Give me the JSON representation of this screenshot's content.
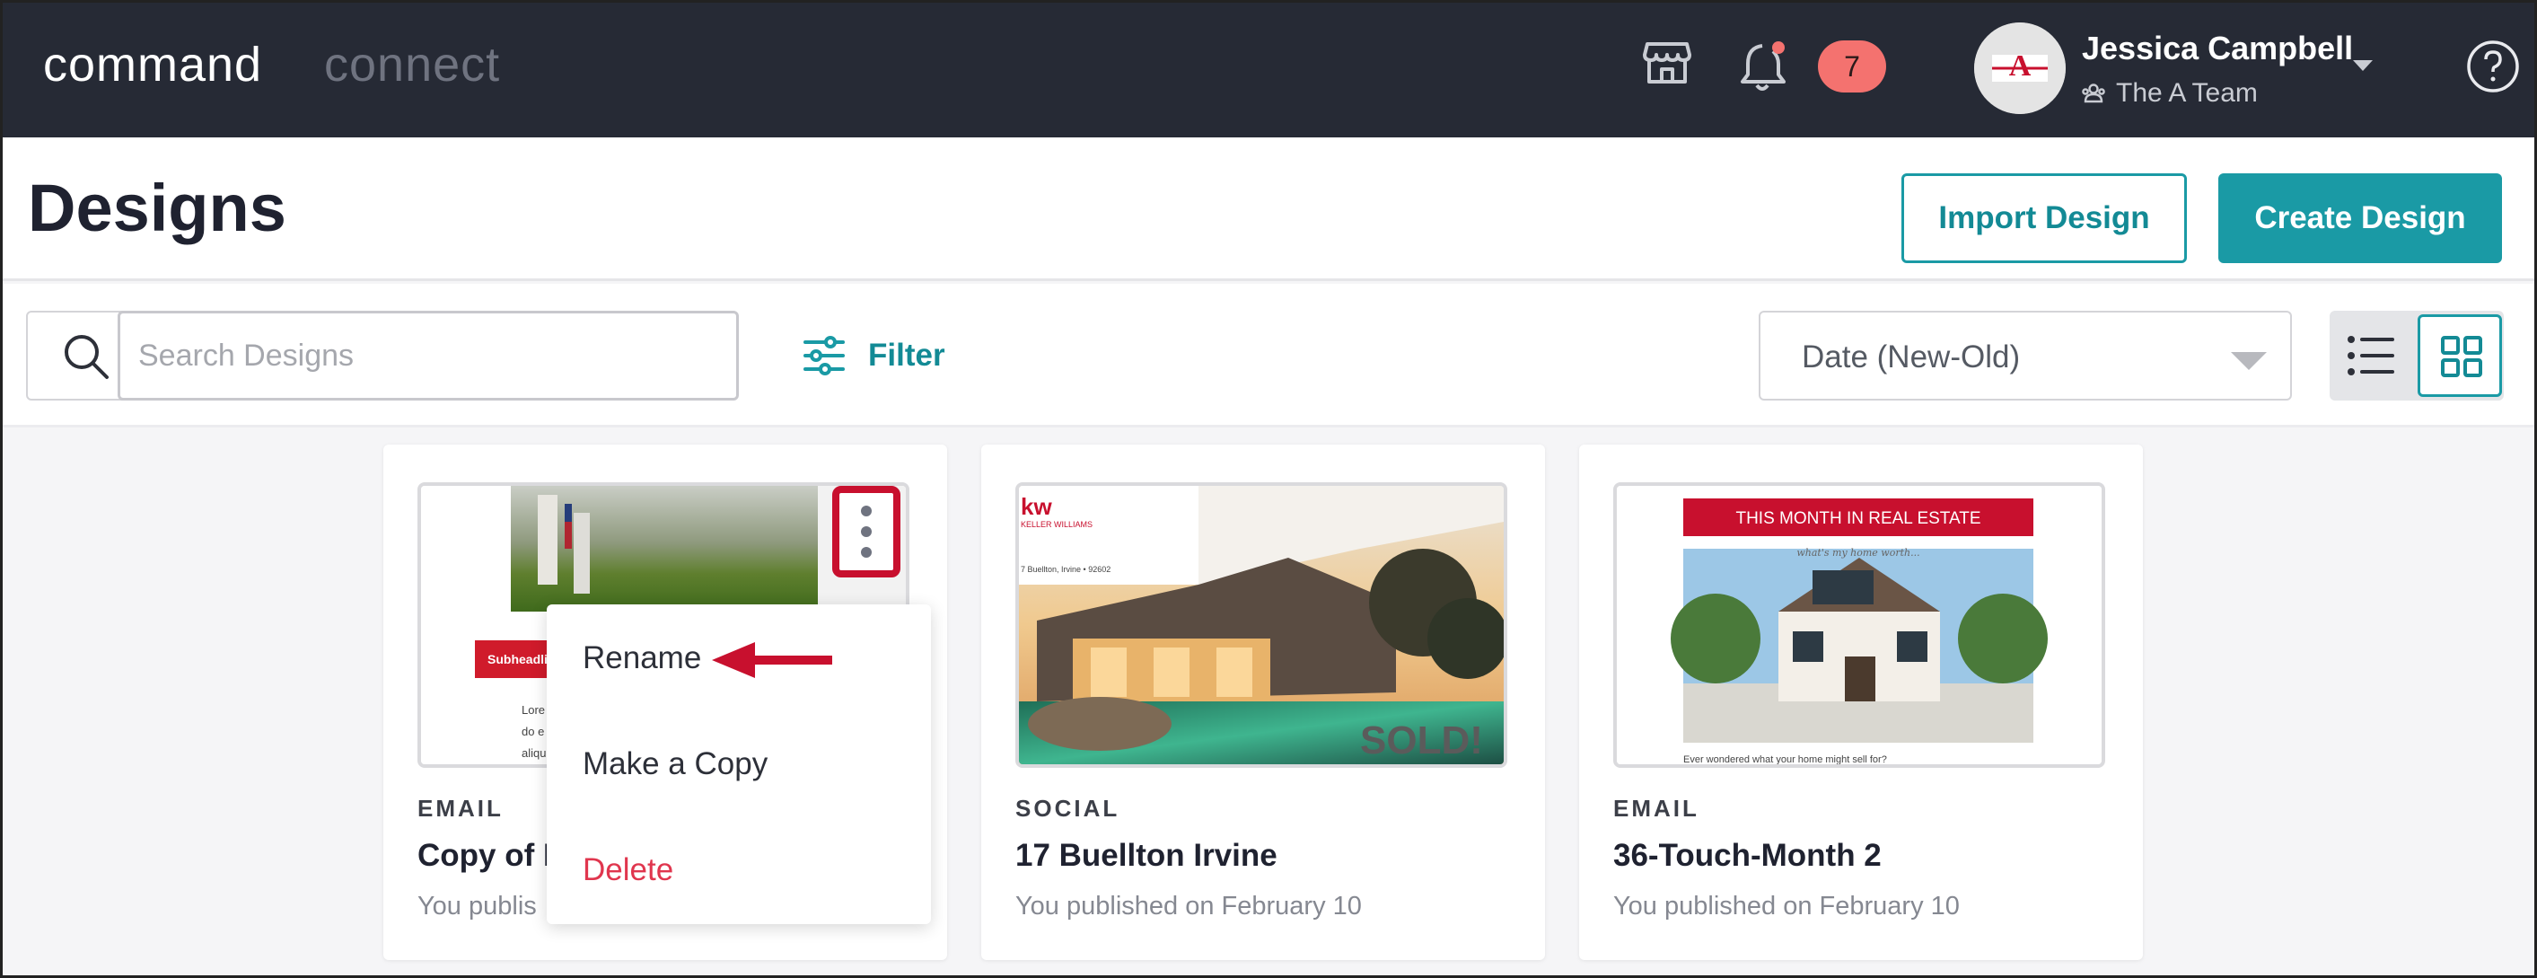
{
  "nav": {
    "brand_active": "command",
    "brand_inactive": "connect",
    "store_icon": "store-icon",
    "bell_icon": "bell-icon",
    "notification_count": "7",
    "user_name": "Jessica Campbell",
    "team_name": "The A Team",
    "avatar_logo_text": "A",
    "help_icon": "help-icon"
  },
  "header": {
    "title": "Designs",
    "import_label": "Import Design",
    "create_label": "Create Design"
  },
  "toolbar": {
    "search_placeholder": "Search Designs",
    "filter_label": "Filter",
    "sort_value": "Date (New-Old)",
    "view_modes": [
      "list",
      "grid"
    ],
    "active_view": "grid"
  },
  "cards": [
    {
      "type": "EMAIL",
      "title": "Copy of I",
      "subtitle": "You publis",
      "thumb_badge": "Subheadli",
      "thumb_text": [
        "Lore",
        "do e",
        "aliqu"
      ]
    },
    {
      "type": "SOCIAL",
      "title": "17 Buellton Irvine",
      "subtitle": "You published on February 10",
      "thumb_brand": "kw",
      "thumb_brand_sub": "KELLER WILLIAMS",
      "thumb_address": "7 Buellton, Irvine • 92602",
      "thumb_overlay": "SOLD!"
    },
    {
      "type": "EMAIL",
      "title": "36-Touch-Month 2",
      "subtitle": "You published on February 10",
      "thumb_banner": "THIS MONTH IN REAL ESTATE",
      "thumb_script": "what's my home worth...",
      "thumb_footer": "Ever wondered what your home might sell for?"
    }
  ],
  "context_menu": {
    "items": [
      {
        "label": "Rename"
      },
      {
        "label": "Make a Copy"
      },
      {
        "label": "Delete"
      }
    ]
  },
  "colors": {
    "teal": "#1a9aa5",
    "navbar": "#262a35",
    "highlight_red": "#c8102e",
    "delete_red": "#e0364e"
  }
}
